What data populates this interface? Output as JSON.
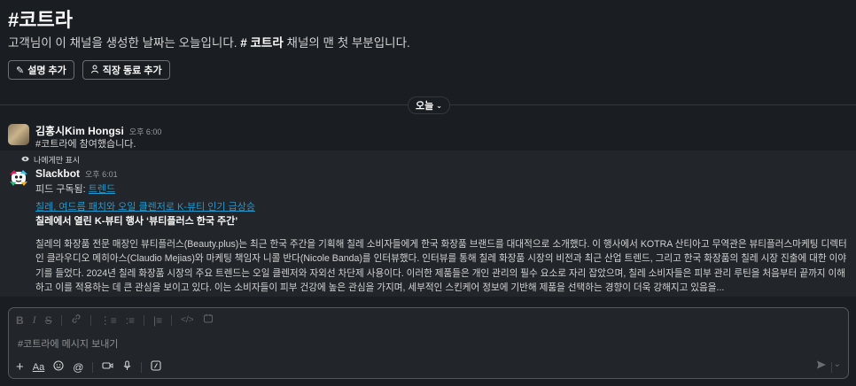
{
  "channel": {
    "title": "#코트라",
    "intro_prefix": "고객님이 이 채널을 생성한 날짜는 오늘입니다. ",
    "intro_bold": "# 코트라",
    "intro_suffix": " 채널의 맨 첫 부분입니다."
  },
  "intro_buttons": {
    "add_description": "설명 추가",
    "add_coworkers": "직장 동료 추가"
  },
  "day_divider": {
    "label": "오늘"
  },
  "messages": {
    "join": {
      "author": "김홍시Kim Hongsi",
      "time": "오후 6:00",
      "text": "#코트라에 참여했습니다."
    },
    "slackbot": {
      "visibility": "나에게만 표시",
      "author": "Slackbot",
      "time": "오후 6:01",
      "feed_prefix": "피드 구독됨: ",
      "feed_link": "트렌드",
      "article_link": "칠레, 여드름 패치와 오일 클렌저로 K-뷰티 인기 급상승",
      "article_title": "칠레에서 열린 K-뷰티 행사 ‘뷰티플러스 한국 주간’",
      "article_body": "칠레의 화장품 전문 매장인 뷰티플러스(Beauty.plus)는 최근 한국 주간을 기획해 칠레 소비자들에게 한국 화장품 브랜드를 대대적으로 소개했다. 이 행사에서 KOTRA 산티아고 무역관은 뷰티플러스마케팅 디렉터인 클라우디오 메히아스(Claudio Mejias)와 마케팅 책임자 니콜 반다(Nicole Banda)를 인터뷰했다. 인터뷰를 통해 칠레 화장품 시장의 비전과 최근 산업 트렌드, 그리고 한국 화장품의 칠레 시장 진출에 대한 이야기를 들었다. 2024년 칠레 화장품 시장의 주요 트렌드는 오일 클렌저와 자외선 차단제 사용이다. 이러한 제품들은 개인 관리의 필수 요소로 자리 잡았으며, 칠레 소비자들은 피부 관리 루틴을 처음부터 끝까지 이해하고 이를 적용하는 데 큰 관심을 보이고 있다. 이는 소비자들이 피부 건강에 높은 관심을 가지며, 세부적인 스킨케어 정보에 기반해 제품을 선택하는 경향이 더욱 강해지고 있음을..."
    }
  },
  "composer": {
    "placeholder": "#코트라에 메시지 보내기",
    "format_label": "Aa"
  }
}
